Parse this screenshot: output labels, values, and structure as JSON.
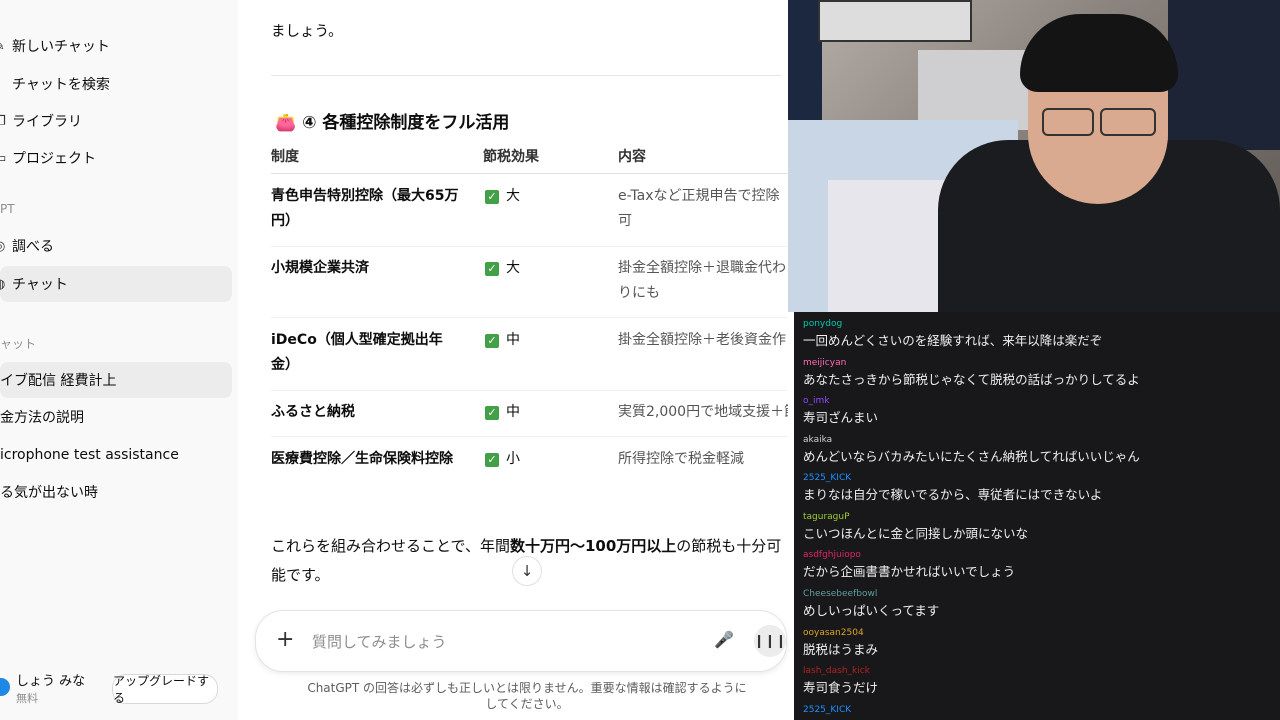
{
  "sidebar": {
    "items": [
      {
        "label": "新しいチャット",
        "icon": "edit-icon"
      },
      {
        "label": "チャットを検索",
        "icon": "search-icon"
      },
      {
        "label": "ライブラリ",
        "icon": "library-icon"
      },
      {
        "label": "プロジェクト",
        "icon": "folder-icon"
      }
    ],
    "section_gpt": "PT",
    "gpts": [
      {
        "label": "調べる",
        "icon": "globe-icon"
      },
      {
        "label": "チャット",
        "icon": "chat-icon"
      }
    ],
    "section_chats": "ャット",
    "chats": [
      "イブ配信 経費計上",
      "金方法の説明",
      "icrophone test assistance",
      "る気が出ない時"
    ],
    "user": {
      "name": "しょう みな",
      "plan": "無料",
      "upgrade": "アップグレードする"
    }
  },
  "main": {
    "top_text": "ましょう。",
    "heading": "④ 各種控除制度をフル活用",
    "heading_icon": "money-bag-icon",
    "table": {
      "headers": [
        "制度",
        "節税効果",
        "内容"
      ],
      "rows": [
        {
          "name": "青色申告特別控除（最大65万円）",
          "effect": "大",
          "desc": "e-Taxなど正規申告で控除可"
        },
        {
          "name": "小規模企業共済",
          "effect": "大",
          "desc": "掛金全額控除＋退職金代わりにも"
        },
        {
          "name": "iDeCo（個人型確定拠出年金）",
          "effect": "中",
          "desc": "掛金全額控除＋老後資金作"
        },
        {
          "name": "ふるさと納税",
          "effect": "中",
          "desc": "実質2,000円で地域支援＋節"
        },
        {
          "name": "医療費控除／生命保険料控除",
          "effect": "小",
          "desc": "所得控除で税金軽減"
        }
      ]
    },
    "paragraph": {
      "p1": "これらを組み合わせることで、年間",
      "b1": "数十万円〜100万円以上",
      "p2": "の節税も十分可能です。"
    },
    "composer_placeholder": "質問してみましょう",
    "disclaimer": "ChatGPT の回答は必ずしも正しいとは限りません。重要な情報は確認するようにしてください。"
  },
  "stream_chat": {
    "messages": [
      {
        "user": "ponydog",
        "color": "#00c8af",
        "text": "一回めんどくさいのを経験すれば、来年以降は楽だぞ"
      },
      {
        "user": "meijicyan",
        "color": "#ff69b4",
        "text": "あなたさっきから節税じゃなくて脱税の話ばっかりしてるよ"
      },
      {
        "user": "o_imk",
        "color": "#9147ff",
        "text": "寿司ざんまい"
      },
      {
        "user": "akaika",
        "color": "#cfcfcf",
        "text": "めんどいならバカみたいにたくさん納税してればいいじゃん"
      },
      {
        "user": "2525_KICK",
        "color": "#1e90ff",
        "text": "まりなは自分で稼いでるから、専従者にはできないよ"
      },
      {
        "user": "taguraguP",
        "color": "#9acd32",
        "text": "こいつほんとに金と同接しか頭にないな"
      },
      {
        "user": "asdfghjuiopo",
        "color": "#e0245e",
        "text": "だから企画書書かせればいいでしょう"
      },
      {
        "user": "Cheesebeefbowl",
        "color": "#5f9ea0",
        "text": "めしいっぱいくってます"
      },
      {
        "user": "ooyasan2504",
        "color": "#daa520",
        "text": "脱税はうまみ"
      },
      {
        "user": "lash_dash_kick",
        "color": "#b22222",
        "text": "寿司食うだけ"
      },
      {
        "user": "2525_KICK",
        "color": "#1e90ff",
        "text": ""
      }
    ]
  }
}
